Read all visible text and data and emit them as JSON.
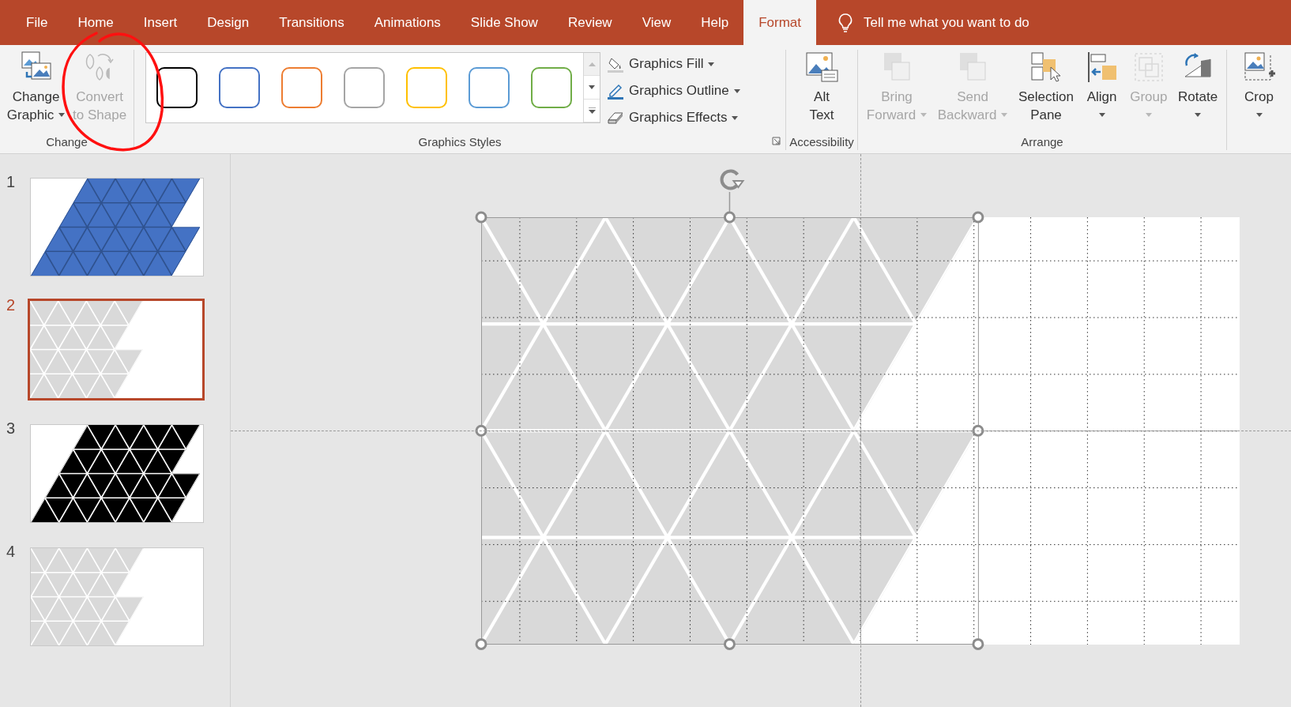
{
  "tabs": [
    {
      "label": "File",
      "selected": false
    },
    {
      "label": "Home",
      "selected": false
    },
    {
      "label": "Insert",
      "selected": false
    },
    {
      "label": "Design",
      "selected": false
    },
    {
      "label": "Transitions",
      "selected": false
    },
    {
      "label": "Animations",
      "selected": false
    },
    {
      "label": "Slide Show",
      "selected": false
    },
    {
      "label": "Review",
      "selected": false
    },
    {
      "label": "View",
      "selected": false
    },
    {
      "label": "Help",
      "selected": false
    },
    {
      "label": "Format",
      "selected": true
    }
  ],
  "tell_me": {
    "placeholder": "Tell me what you want to do"
  },
  "change_group": {
    "label": "Change",
    "buttons": [
      {
        "lines": [
          "Change",
          "Graphic"
        ],
        "dropdown": true,
        "disabled": false
      },
      {
        "lines": [
          "Convert",
          "to Shape"
        ],
        "dropdown": false,
        "disabled": true
      }
    ]
  },
  "styles_group": {
    "label": "Graphics Styles",
    "swatches": [
      {
        "color": "#000000"
      },
      {
        "color": "#4472c4"
      },
      {
        "color": "#ed7d31"
      },
      {
        "color": "#a5a5a5"
      },
      {
        "color": "#ffc000"
      },
      {
        "color": "#5b9bd5"
      },
      {
        "color": "#70ad47"
      }
    ],
    "commands": [
      {
        "label": "Graphics Fill"
      },
      {
        "label": "Graphics Outline"
      },
      {
        "label": "Graphics Effects"
      }
    ]
  },
  "accessibility_group": {
    "label": "Accessibility",
    "button": {
      "lines": [
        "Alt",
        "Text"
      ],
      "dropdown": false,
      "disabled": false
    }
  },
  "arrange_group": {
    "label": "Arrange",
    "buttons": [
      {
        "lines": [
          "Bring",
          "Forward"
        ],
        "dropdown": true,
        "disabled": true
      },
      {
        "lines": [
          "Send",
          "Backward"
        ],
        "dropdown": true,
        "disabled": true
      },
      {
        "lines": [
          "Selection",
          "Pane"
        ],
        "dropdown": false,
        "disabled": false
      },
      {
        "lines": [
          "Align"
        ],
        "dropdown": true,
        "disabled": false
      },
      {
        "lines": [
          "Group"
        ],
        "dropdown": true,
        "disabled": true
      },
      {
        "lines": [
          "Rotate"
        ],
        "dropdown": true,
        "disabled": false
      }
    ]
  },
  "crop_button": {
    "lines": [
      "Crop"
    ],
    "dropdown": true,
    "disabled": false
  },
  "slides": [
    {
      "number": "1",
      "selected": false,
      "slanted": true,
      "fill": {
        "color": "#4472c4"
      },
      "lines": {
        "color": "#2f528f"
      }
    },
    {
      "number": "2",
      "selected": true,
      "slanted": false,
      "fill": {
        "color": "#d9d9d9"
      },
      "lines": {
        "color": "#ffffff"
      }
    },
    {
      "number": "3",
      "selected": false,
      "slanted": true,
      "fill": {
        "color": "#000000"
      },
      "lines": {
        "color": "#ffffff"
      }
    },
    {
      "number": "4",
      "selected": false,
      "slanted": false,
      "fill": {
        "color": "#d9d9d9"
      },
      "lines": {
        "color": "#ffffff"
      }
    }
  ],
  "slide": {
    "slanted": false,
    "fill": {
      "color": "#d9d9d9"
    },
    "lines": {
      "color": "#ffffff"
    },
    "selected": true
  }
}
